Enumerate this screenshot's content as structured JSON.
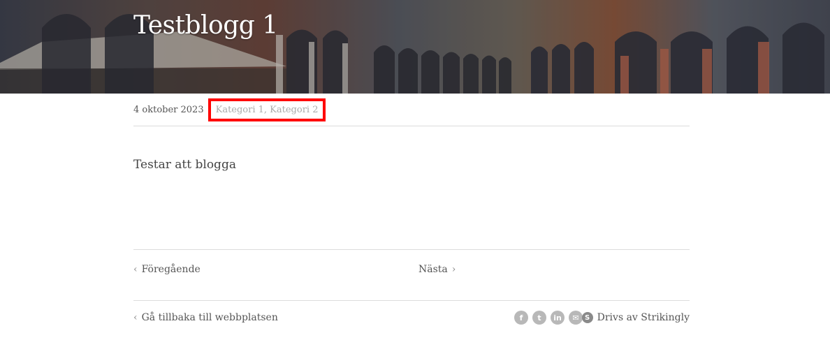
{
  "post": {
    "title": "Testblogg 1",
    "date": "4 oktober 2023",
    "categories": "Kategori 1, Kategori 2",
    "body": "Testar att blogga"
  },
  "pager": {
    "prev_label": "Föregående",
    "next_label": "Nästa"
  },
  "footer": {
    "back_label": "Gå tillbaka till webbplatsen",
    "powered_label": "Drivs av Strikingly",
    "social_icons": [
      "facebook-icon",
      "twitter-icon",
      "linkedin-icon",
      "email-icon"
    ]
  },
  "colors": {
    "highlight_border": "#ff0000",
    "category_text": "#aaaaaa"
  }
}
